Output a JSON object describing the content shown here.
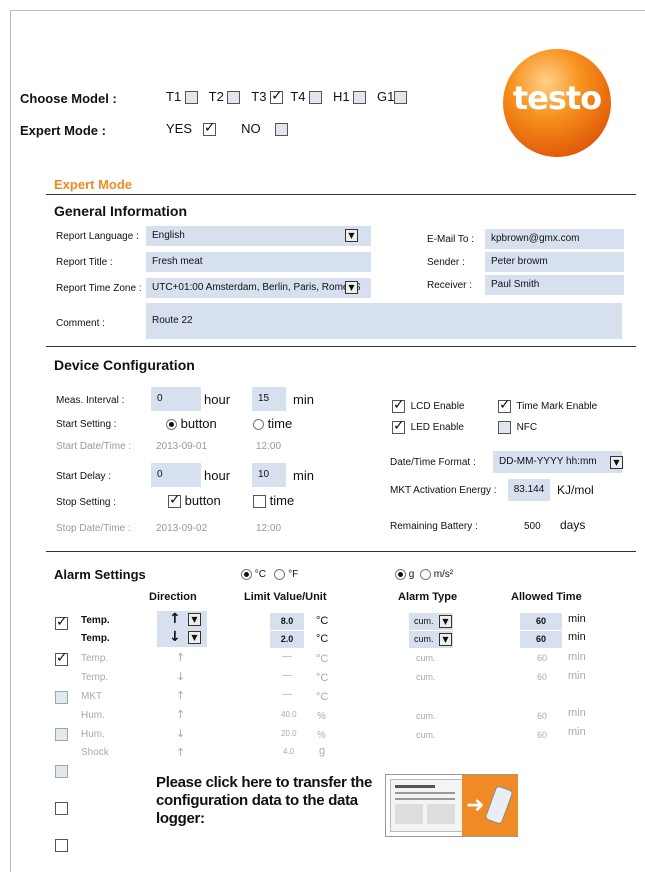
{
  "header": {
    "choose_model_label": "Choose Model :",
    "models": [
      {
        "label": "T1",
        "checked": false
      },
      {
        "label": "T2",
        "checked": false
      },
      {
        "label": "T3",
        "checked": true
      },
      {
        "label": "T4",
        "checked": false
      },
      {
        "label": "H1",
        "checked": false
      },
      {
        "label": "G1",
        "checked": false
      }
    ],
    "expert_mode_label": "Expert Mode :",
    "yes_label": "YES",
    "no_label": "NO",
    "logo_text": "testo"
  },
  "section_title": "Expert Mode",
  "general": {
    "title": "General Information",
    "report_language_label": "Report Language :",
    "report_language_value": "English",
    "report_title_label": "Report Title :",
    "report_title_value": "Fresh meat",
    "time_zone_label": "Report Time Zone :",
    "time_zone_value": "UTC+01:00  Amsterdam, Berlin, Paris, Rome, S",
    "comment_label": "Comment :",
    "comment_value": "Route 22",
    "email_label": "E-Mail To :",
    "email_value": "kpbrown@gmx.com",
    "sender_label": "Sender :",
    "sender_value": "Peter browm",
    "receiver_label": "Receiver :",
    "receiver_value": "Paul Smith"
  },
  "device": {
    "title": "Device Configuration",
    "meas_interval_label": "Meas. Interval :",
    "meas_hour_value": "0",
    "hour_label": "hour",
    "meas_min_value": "15",
    "min_label": "min",
    "start_setting_label": "Start Setting :",
    "button_label": "button",
    "time_label": "time",
    "start_datetime_label": "Start Date/Time :",
    "start_date_value": "2013-09-01",
    "start_time_value": "12:00",
    "start_delay_label": "Start Delay :",
    "delay_hour_value": "0",
    "delay_min_value": "10",
    "stop_setting_label": "Stop Setting :",
    "stop_datetime_label": "Stop Date/Time :",
    "stop_date_value": "2013-09-02",
    "stop_time_value": "12:00",
    "lcd_label": "LCD Enable",
    "time_mark_label": "Time Mark Enable",
    "led_label": "LED Enable",
    "nfc_label": "NFC",
    "datetime_format_label": "Date/Time Format :",
    "datetime_format_value": "DD-MM-YYYY  hh:mm",
    "mkt_label": "MKT Activation Energy :",
    "mkt_value": "83.144",
    "mkt_unit": "KJ/mol",
    "battery_label": "Remaining Battery :",
    "battery_value": "500",
    "battery_unit": "days"
  },
  "alarm": {
    "title": "Alarm Settings",
    "unit_c": "°C",
    "unit_f": "°F",
    "unit_g": "g",
    "unit_ms2": "m/s²",
    "col_direction": "Direction",
    "col_limit": "Limit Value/Unit",
    "col_type": "Alarm Type",
    "col_time": "Allowed Time",
    "rows": [
      {
        "name": "Temp.",
        "arrow": "↑",
        "limit": "8.0",
        "unit": "°C",
        "type": "cum.",
        "time": "60",
        "time_unit": "min"
      },
      {
        "name": "Temp.",
        "arrow": "↓",
        "limit": "2.0",
        "unit": "°C",
        "type": "cum.",
        "time": "60",
        "time_unit": "min"
      },
      {
        "name": "Temp.",
        "arrow": "↑",
        "limit": "—",
        "unit": "°C",
        "type": "cum.",
        "time": "60",
        "time_unit": "min"
      },
      {
        "name": "Temp.",
        "arrow": "↓",
        "limit": "—",
        "unit": "°C",
        "type": "cum.",
        "time": "60",
        "time_unit": "min"
      },
      {
        "name": "MKT",
        "arrow": "↑",
        "limit": "—",
        "unit": "°C",
        "type": "",
        "time": "",
        "time_unit": ""
      },
      {
        "name": "Hum.",
        "arrow": "↑",
        "limit": "40.0",
        "unit": "%",
        "type": "cum.",
        "time": "60",
        "time_unit": "min"
      },
      {
        "name": "Hum.",
        "arrow": "↓",
        "limit": "20.0",
        "unit": "%",
        "type": "cum.",
        "time": "60",
        "time_unit": "min"
      },
      {
        "name": "Shock",
        "arrow": "↑",
        "limit": "4.0",
        "unit": "g",
        "type": "",
        "time": "",
        "time_unit": ""
      }
    ]
  },
  "transfer": {
    "text": "Please click here to transfer the configuration data to the data logger:"
  }
}
